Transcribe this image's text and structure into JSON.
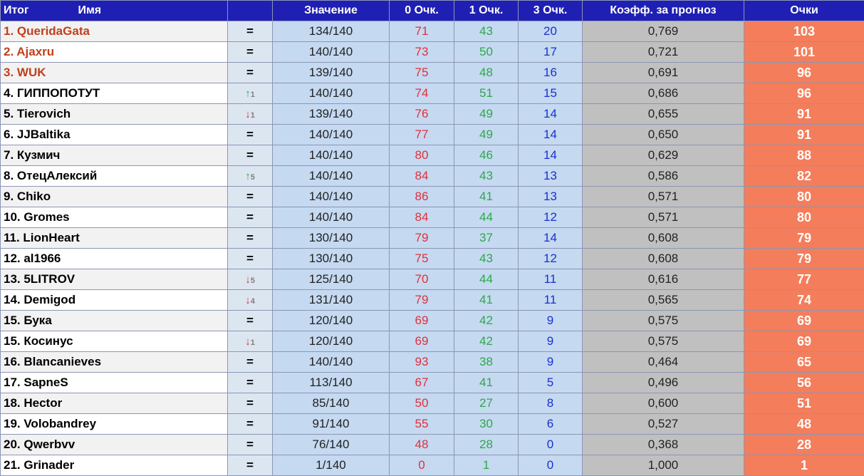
{
  "header": {
    "itog": "Итог",
    "name": "Имя",
    "change": "",
    "value": "Значение",
    "zero": "0 Очк.",
    "one": "1 Очк.",
    "three": "3 Очк.",
    "coef": "Коэфф. за прогноз",
    "points": "Очки"
  },
  "rows": [
    {
      "name": "1. QueridaGata",
      "top": true,
      "change": "=",
      "dir": "eq",
      "delta": "",
      "value": "134/140",
      "zero": "71",
      "one": "43",
      "three": "20",
      "coef": "0,769",
      "points": "103"
    },
    {
      "name": "2. Ajaxru",
      "top": true,
      "change": "=",
      "dir": "eq",
      "delta": "",
      "value": "140/140",
      "zero": "73",
      "one": "50",
      "three": "17",
      "coef": "0,721",
      "points": "101"
    },
    {
      "name": "3. WUK",
      "top": true,
      "change": "=",
      "dir": "eq",
      "delta": "",
      "value": "139/140",
      "zero": "75",
      "one": "48",
      "three": "16",
      "coef": "0,691",
      "points": "96"
    },
    {
      "name": "4. ГИППОПОТУТ",
      "top": false,
      "change": "↑",
      "dir": "up",
      "delta": "1",
      "value": "140/140",
      "zero": "74",
      "one": "51",
      "three": "15",
      "coef": "0,686",
      "points": "96"
    },
    {
      "name": "5. Tierovich",
      "top": false,
      "change": "↓",
      "dir": "down",
      "delta": "1",
      "value": "139/140",
      "zero": "76",
      "one": "49",
      "three": "14",
      "coef": "0,655",
      "points": "91"
    },
    {
      "name": "6. JJBaltika",
      "top": false,
      "change": "=",
      "dir": "eq",
      "delta": "",
      "value": "140/140",
      "zero": "77",
      "one": "49",
      "three": "14",
      "coef": "0,650",
      "points": "91"
    },
    {
      "name": "7. Кузмич",
      "top": false,
      "change": "=",
      "dir": "eq",
      "delta": "",
      "value": "140/140",
      "zero": "80",
      "one": "46",
      "three": "14",
      "coef": "0,629",
      "points": "88"
    },
    {
      "name": "8. ОтецАлексий",
      "top": false,
      "change": "↑",
      "dir": "up",
      "delta": "5",
      "value": "140/140",
      "zero": "84",
      "one": "43",
      "three": "13",
      "coef": "0,586",
      "points": "82"
    },
    {
      "name": "9. Chiko",
      "top": false,
      "change": "=",
      "dir": "eq",
      "delta": "",
      "value": "140/140",
      "zero": "86",
      "one": "41",
      "three": "13",
      "coef": "0,571",
      "points": "80"
    },
    {
      "name": "10. Gromes",
      "top": false,
      "change": "=",
      "dir": "eq",
      "delta": "",
      "value": "140/140",
      "zero": "84",
      "one": "44",
      "three": "12",
      "coef": "0,571",
      "points": "80"
    },
    {
      "name": "11. LionHeart",
      "top": false,
      "change": "=",
      "dir": "eq",
      "delta": "",
      "value": "130/140",
      "zero": "79",
      "one": "37",
      "three": "14",
      "coef": "0,608",
      "points": "79"
    },
    {
      "name": "12. al1966",
      "top": false,
      "change": "=",
      "dir": "eq",
      "delta": "",
      "value": "130/140",
      "zero": "75",
      "one": "43",
      "three": "12",
      "coef": "0,608",
      "points": "79"
    },
    {
      "name": "13. 5LITROV",
      "top": false,
      "change": "↓",
      "dir": "down",
      "delta": "5",
      "value": "125/140",
      "zero": "70",
      "one": "44",
      "three": "11",
      "coef": "0,616",
      "points": "77"
    },
    {
      "name": "14. Demigod",
      "top": false,
      "change": "↓",
      "dir": "down",
      "delta": "4",
      "value": "131/140",
      "zero": "79",
      "one": "41",
      "three": "11",
      "coef": "0,565",
      "points": "74"
    },
    {
      "name": "15. Бука",
      "top": false,
      "change": "=",
      "dir": "eq",
      "delta": "",
      "value": "120/140",
      "zero": "69",
      "one": "42",
      "three": "9",
      "coef": "0,575",
      "points": "69"
    },
    {
      "name": "15. Косинус",
      "top": false,
      "change": "↓",
      "dir": "down",
      "delta": "1",
      "value": "120/140",
      "zero": "69",
      "one": "42",
      "three": "9",
      "coef": "0,575",
      "points": "69"
    },
    {
      "name": "16. Blancanieves",
      "top": false,
      "change": "=",
      "dir": "eq",
      "delta": "",
      "value": "140/140",
      "zero": "93",
      "one": "38",
      "three": "9",
      "coef": "0,464",
      "points": "65"
    },
    {
      "name": "17. SapneS",
      "top": false,
      "change": "=",
      "dir": "eq",
      "delta": "",
      "value": "113/140",
      "zero": "67",
      "one": "41",
      "three": "5",
      "coef": "0,496",
      "points": "56"
    },
    {
      "name": "18. Hector",
      "top": false,
      "change": "=",
      "dir": "eq",
      "delta": "",
      "value": "85/140",
      "zero": "50",
      "one": "27",
      "three": "8",
      "coef": "0,600",
      "points": "51"
    },
    {
      "name": "19. Volobandrey",
      "top": false,
      "change": "=",
      "dir": "eq",
      "delta": "",
      "value": "91/140",
      "zero": "55",
      "one": "30",
      "three": "6",
      "coef": "0,527",
      "points": "48"
    },
    {
      "name": "20. Qwerbvv",
      "top": false,
      "change": "=",
      "dir": "eq",
      "delta": "",
      "value": "76/140",
      "zero": "48",
      "one": "28",
      "three": "0",
      "coef": "0,368",
      "points": "28"
    },
    {
      "name": "21. Grinader",
      "top": false,
      "change": "=",
      "dir": "eq",
      "delta": "",
      "value": "1/140",
      "zero": "0",
      "one": "1",
      "three": "0",
      "coef": "1,000",
      "points": "1"
    }
  ],
  "colors": {
    "header_bg": "#1f1fb4",
    "top_name": "#c0401a",
    "zero_points": "#e0303a",
    "one_point": "#2ea84a",
    "three_points": "#1a2fd0",
    "points_bg": "#f47d5b",
    "coef_bg": "#c0c0c0",
    "value_bg": "#c5d9f1"
  }
}
